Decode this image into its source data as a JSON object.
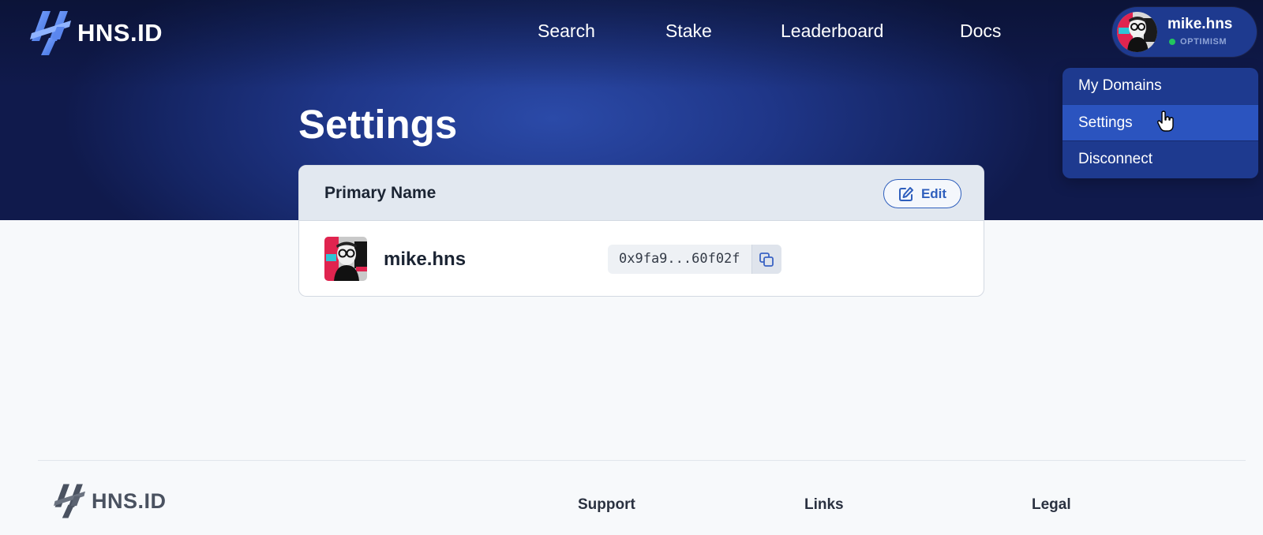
{
  "brand": {
    "name": "HNS.ID",
    "accent": "#2f5fbd",
    "hero_bg": "#1a2d78"
  },
  "nav": {
    "items": [
      "Search",
      "Stake",
      "Leaderboard",
      "Docs"
    ]
  },
  "account": {
    "name": "mike.hns",
    "network": "OPTIMISM",
    "status_color": "#22c55e"
  },
  "account_menu": {
    "items": [
      "My Domains",
      "Settings",
      "Disconnect"
    ],
    "active": "Settings"
  },
  "page": {
    "title": "Settings"
  },
  "primary_name_card": {
    "header": "Primary Name",
    "edit_label": "Edit",
    "name": "mike.hns",
    "address": "0x9fa9...60f02f"
  },
  "footer": {
    "columns": [
      "Support",
      "Links",
      "Legal"
    ]
  }
}
